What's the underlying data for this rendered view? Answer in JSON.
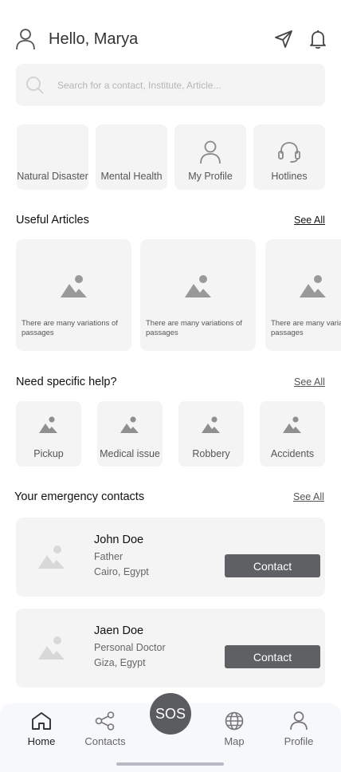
{
  "header": {
    "greeting": "Hello, Marya"
  },
  "search": {
    "placeholder": "Search for a contact, Institute, Article..."
  },
  "quick_actions": [
    {
      "label": "Natural Disaster",
      "icon": "none"
    },
    {
      "label": "Mental Health",
      "icon": "none"
    },
    {
      "label": "My Profile",
      "icon": "user-icon"
    },
    {
      "label": "Hotlines",
      "icon": "headset-icon"
    }
  ],
  "articles_section": {
    "title": "Useful Articles",
    "see_all": "See All"
  },
  "articles": [
    {
      "text": "There are many variations of passages"
    },
    {
      "text": "There are many variations of passages"
    },
    {
      "text": "There are many variations of passages"
    }
  ],
  "help_section": {
    "title": "Need specific help?",
    "see_all": "See All"
  },
  "help_items": [
    {
      "label": "Pickup"
    },
    {
      "label": "Medical issue"
    },
    {
      "label": "Robbery"
    },
    {
      "label": "Accidents"
    }
  ],
  "contacts_section": {
    "title": "Your emergency contacts",
    "see_all": "See All"
  },
  "contacts": [
    {
      "name": "John Doe",
      "role": "Father",
      "location": "Cairo, Egypt",
      "button": "Contact"
    },
    {
      "name": "Jaen Doe",
      "role": "Personal Doctor",
      "location": "Giza, Egypt",
      "button": "Contact"
    }
  ],
  "nav": {
    "sos": "SOS",
    "items": [
      {
        "label": "Home",
        "icon": "home-icon",
        "active": true
      },
      {
        "label": "Contacts",
        "icon": "share-icon",
        "active": false
      },
      {
        "label": "Map",
        "icon": "globe-icon",
        "active": false
      },
      {
        "label": "Profile",
        "icon": "user-icon",
        "active": false
      }
    ]
  },
  "colors": {
    "card_bg": "#f4f4f4",
    "button": "#5f6063",
    "sos": "#5b5c60",
    "nav_bg": "#f7f8fc"
  }
}
